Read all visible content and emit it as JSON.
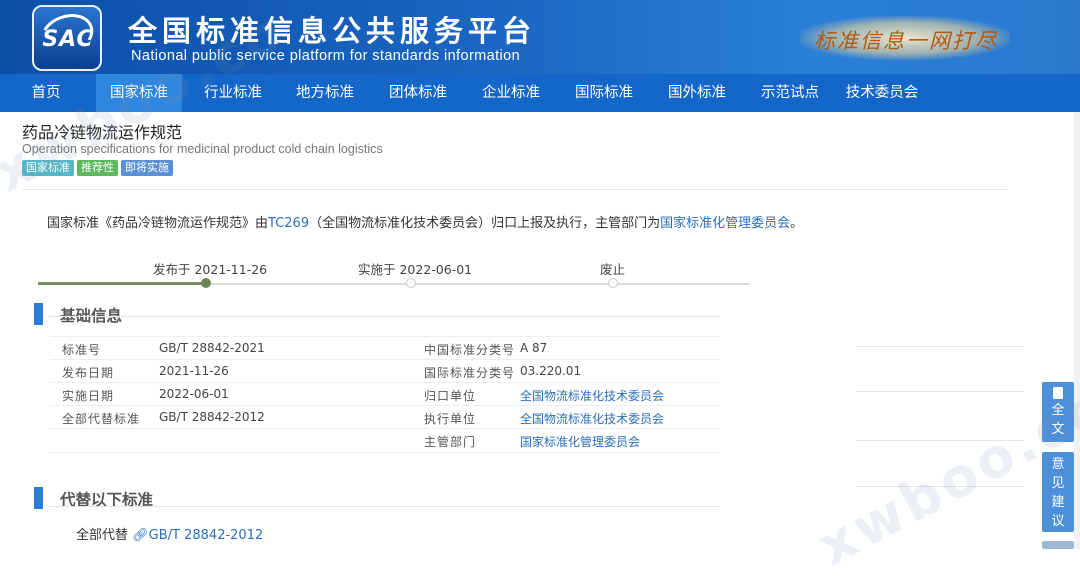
{
  "header": {
    "logo_text": "SAC",
    "title": "全国标准信息公共服务平台",
    "subtitle": "National public service platform  for standards information",
    "slogan": "标准信息一网打尽"
  },
  "nav": {
    "items": [
      {
        "label": "首页"
      },
      {
        "label": "国家标准",
        "active": true
      },
      {
        "label": "行业标准"
      },
      {
        "label": "地方标准"
      },
      {
        "label": "团体标准"
      },
      {
        "label": "企业标准"
      },
      {
        "label": "国际标准"
      },
      {
        "label": "国外标准"
      },
      {
        "label": "示范试点"
      },
      {
        "label": "技术委员会"
      }
    ]
  },
  "standard": {
    "title_cn": "药品冷链物流运作规范",
    "title_en": "Operation specifications for medicinal product cold chain logistics",
    "badges": [
      {
        "label": "国家标准",
        "color": "#56b6c9"
      },
      {
        "label": "推荐性",
        "color": "#5cb85c"
      },
      {
        "label": "即将实施",
        "color": "#5b8fd6"
      }
    ]
  },
  "intro": {
    "prefix": "国家标准《药品冷链物流运作规范》由",
    "tc_link": "TC269",
    "middle": "（全国物流标准化技术委员会）归口上报及执行，主管部门为",
    "dept_link": "国家标准化管理委员会",
    "suffix": "。"
  },
  "timeline": {
    "publish": "发布于 2021-11-26",
    "implement": "实施于 2022-06-01",
    "abolish": "废止"
  },
  "basic_info": {
    "heading": "基础信息",
    "left": [
      {
        "label": "标准号",
        "value": "GB/T 28842-2021"
      },
      {
        "label": "发布日期",
        "value": "2021-11-26"
      },
      {
        "label": "实施日期",
        "value": "2022-06-01"
      },
      {
        "label": "全部代替标准",
        "value": "GB/T 28842-2012"
      }
    ],
    "right": [
      {
        "label": "中国标准分类号",
        "value": "A 87"
      },
      {
        "label": "国际标准分类号",
        "value": "03.220.01"
      },
      {
        "label": "归口单位",
        "value": "全国物流标准化技术委员会"
      },
      {
        "label": "执行单位",
        "value": "全国物流标准化技术委员会"
      },
      {
        "label": "主管部门",
        "value": "国家标准化管理委员会"
      }
    ]
  },
  "replace": {
    "heading": "代替以下标准",
    "label": "全部代替",
    "link": "GB/T 28842-2012"
  },
  "sidebar": {
    "fulltext": [
      "全",
      "文"
    ],
    "feedback": [
      "意",
      "见",
      "建",
      "议"
    ]
  },
  "watermark": {
    "left": "xwboo.co",
    "right": "xwboo.com"
  }
}
